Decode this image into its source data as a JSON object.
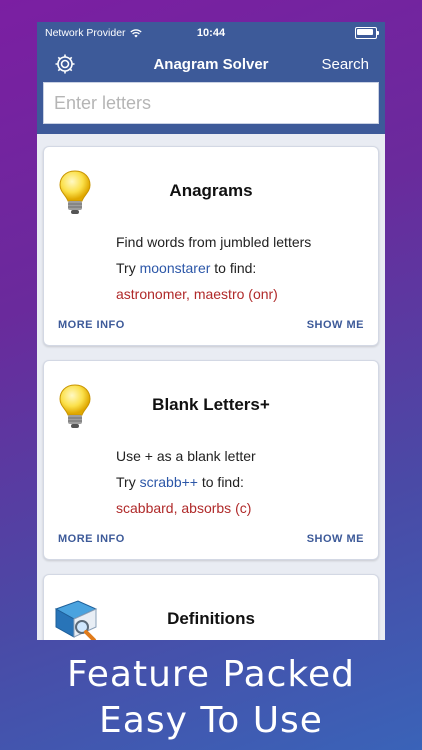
{
  "status_bar": {
    "carrier": "Network Provider",
    "time": "10:44",
    "battery_level": 0.9
  },
  "header": {
    "title": "Anagram Solver",
    "search_label": "Search",
    "settings_icon": "gear-icon"
  },
  "search": {
    "placeholder": "Enter letters",
    "value": ""
  },
  "cards": [
    {
      "title": "Anagrams",
      "icon": "lightbulb-icon",
      "line1": "Find words from jumbled letters",
      "try_prefix": "Try",
      "try_word": "moonstarer",
      "try_suffix": "to find:",
      "result": "astronomer, maestro (onr)",
      "more_info": "MORE INFO",
      "show_me": "SHOW ME"
    },
    {
      "title": "Blank Letters+",
      "icon": "lightbulb-icon",
      "line1": "Use + as a blank letter",
      "try_prefix": "Try",
      "try_word": "scrabb++",
      "try_suffix": "to find:",
      "result": "scabbard, absorbs (c)",
      "more_info": "MORE INFO",
      "show_me": "SHOW ME"
    },
    {
      "title": "Definitions",
      "icon": "dictionary-book-icon"
    }
  ],
  "caption": {
    "line1": "Feature Packed",
    "line2": "Easy To Use"
  },
  "colors": {
    "nav": "#3d5a99",
    "link": "#2c57a8",
    "result": "#b02a2a",
    "bg_start": "#7b1fa2",
    "bg_end": "#3a63b8"
  }
}
